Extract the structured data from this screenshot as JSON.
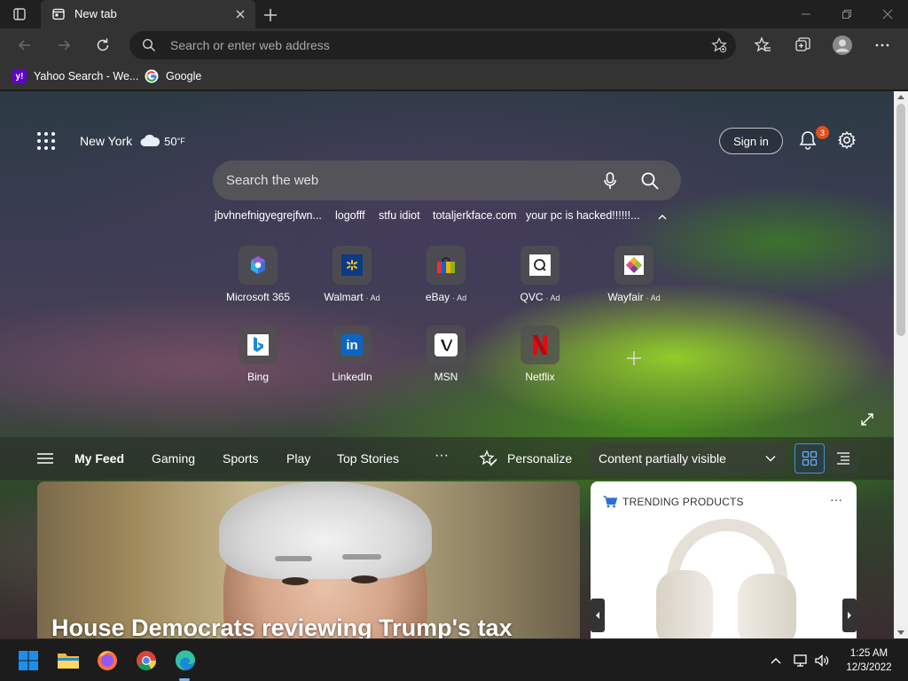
{
  "browser": {
    "tab": {
      "title": "New tab"
    },
    "address_bar": {
      "placeholder": "Search or enter web address",
      "value": ""
    },
    "bookmarks": [
      {
        "label": "Yahoo Search - We...",
        "icon": "yahoo-icon"
      },
      {
        "label": "Google",
        "icon": "google-icon"
      }
    ]
  },
  "new_tab_page": {
    "weather": {
      "city": "New York",
      "temp": "50",
      "unit": "°F",
      "icon": "cloud-icon"
    },
    "sign_in_label": "Sign in",
    "notifications_count": "3",
    "search": {
      "placeholder": "Search the web"
    },
    "recent_searches": [
      "jbvhnefnigyegrejfwn...",
      "logofff",
      "stfu idiot",
      "totaljerkface.com",
      "your pc is hacked!!!!!!..."
    ],
    "quick_links": [
      {
        "label": "Microsoft 365",
        "ad": ""
      },
      {
        "label": "Walmart",
        "ad": "Ad"
      },
      {
        "label": "eBay",
        "ad": "Ad"
      },
      {
        "label": "QVC",
        "ad": "Ad"
      },
      {
        "label": "Wayfair",
        "ad": "Ad"
      },
      {
        "label": "Bing",
        "ad": ""
      },
      {
        "label": "LinkedIn",
        "ad": ""
      },
      {
        "label": "MSN",
        "ad": ""
      },
      {
        "label": "Netflix",
        "ad": ""
      }
    ],
    "feed_tabs": [
      "My Feed",
      "Gaming",
      "Sports",
      "Play",
      "Top Stories"
    ],
    "more_label": "···",
    "personalize_label": "Personalize",
    "content_visibility": "Content partially visible",
    "hero": {
      "headline": "House Democrats reviewing Trump's tax"
    },
    "trending": {
      "title": "TRENDING PRODUCTS",
      "more": "···"
    }
  },
  "taskbar": {
    "time": "1:25 AM",
    "date": "12/3/2022",
    "apps": [
      "start-icon",
      "file-explorer-icon",
      "firefox-icon",
      "chrome-icon",
      "edge-icon"
    ]
  },
  "colors": {
    "chrome_dark": "#202020",
    "toolbar": "#333333",
    "accent_blue": "#4a90d9",
    "badge_orange": "#e05020"
  }
}
